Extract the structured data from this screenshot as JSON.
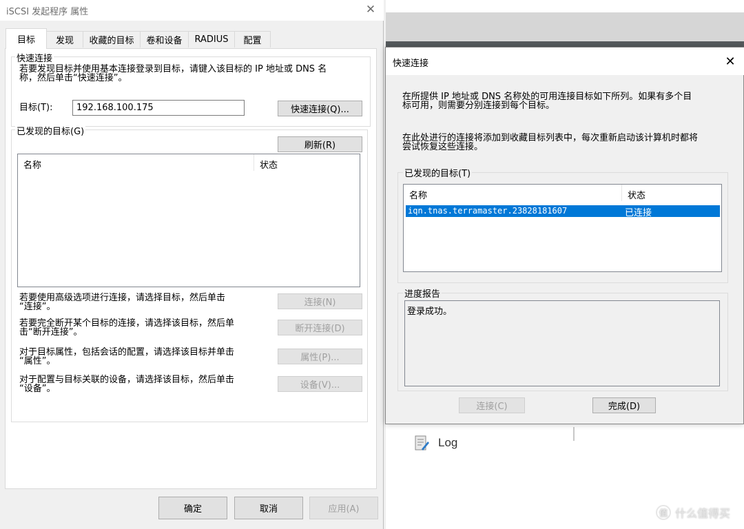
{
  "background": {
    "log_label": "Log",
    "watermark_logo": "值",
    "watermark_text": "什么值得买"
  },
  "main_dialog": {
    "title": "iSCSI 发起程序 属性",
    "close_glyph": "✕",
    "tabs": [
      {
        "label": "目标"
      },
      {
        "label": "发现"
      },
      {
        "label": "收藏的目标"
      },
      {
        "label": "卷和设备"
      },
      {
        "label": "RADIUS"
      },
      {
        "label": "配置"
      }
    ],
    "quick_connect": {
      "group_label": "快速连接",
      "description_line1": "若要发现目标并使用基本连接登录到目标，请键入该目标的 IP 地址或 DNS 名",
      "description_line2": "称，然后单击“快速连接”。",
      "target_label": "目标(T):",
      "target_value": "192.168.100.175",
      "quick_connect_button": "快速连接(Q)..."
    },
    "discovered": {
      "group_label": "已发现的目标(G)",
      "refresh_button": "刷新(R)",
      "columns": [
        "名称",
        "状态"
      ]
    },
    "actions": [
      {
        "line1": "若要使用高级选项进行连接，请选择目标，然后单击",
        "line2": "“连接”。",
        "button": "连接(N)"
      },
      {
        "line1": "若要完全断开某个目标的连接，请选择该目标，然后单",
        "line2": "击“断开连接”。",
        "button": "断开连接(D)"
      },
      {
        "line1": "对于目标属性，包括会话的配置，请选择该目标并单击",
        "line2": "“属性”。",
        "button": "属性(P)..."
      },
      {
        "line1": "对于配置与目标关联的设备，请选择该目标，然后单击",
        "line2": "“设备”。",
        "button": "设备(V)..."
      }
    ],
    "bottom_buttons": {
      "ok": "确定",
      "cancel": "取消",
      "apply": "应用(A)"
    }
  },
  "quick_connect_dialog": {
    "title": "快速连接",
    "close_glyph": "✕",
    "intro_line1": "在所提供 IP 地址或 DNS 名称处的可用连接目标如下所列。如果有多个目",
    "intro_line2": "标可用，则需要分别连接到每个目标。",
    "note_line1": "在此处进行的连接将添加到收藏目标列表中，每次重新启动该计算机时都将",
    "note_line2": "尝试恢复这些连接。",
    "discovered_label": "已发现的目标(T)",
    "columns": [
      "名称",
      "状态"
    ],
    "targets": [
      {
        "name": "iqn.tnas.terramaster.23828181607",
        "status": "已连接"
      }
    ],
    "progress_label": "进度报告",
    "progress_text": "登录成功。",
    "connect_button": "连接(C)",
    "done_button": "完成(D)"
  }
}
